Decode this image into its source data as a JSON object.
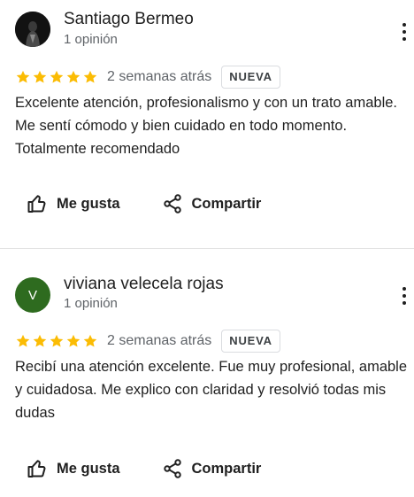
{
  "reviews": [
    {
      "name": "Santiago Bermeo",
      "subtitle": "1 opinión",
      "avatar": "photo",
      "rating": 5,
      "time": "2 semanas atrás",
      "badge": "NUEVA",
      "text": "Excelente atención, profesionalismo y con un trato amable. Me sentí cómodo y bien cuidado en todo momento. Totalmente recomendado",
      "like_label": "Me gusta",
      "share_label": "Compartir"
    },
    {
      "name": "viviana velecela rojas",
      "subtitle": "1 opinión",
      "avatar_letter": "V",
      "avatar_color": "#2e6b1f",
      "rating": 5,
      "time": "2 semanas atrás",
      "badge": "NUEVA",
      "text": "Recibí una atención excelente. Fue muy profesional, amable y cuidadosa. Me explico con claridad y resolvió todas mis dudas",
      "like_label": "Me gusta",
      "share_label": "Compartir"
    }
  ],
  "colors": {
    "star": "#fbbc04",
    "text": "#1f1f1f",
    "muted": "#5f6368"
  },
  "icons": [
    "more-vert-icon",
    "star-icon",
    "thumb-up-icon",
    "share-icon"
  ]
}
